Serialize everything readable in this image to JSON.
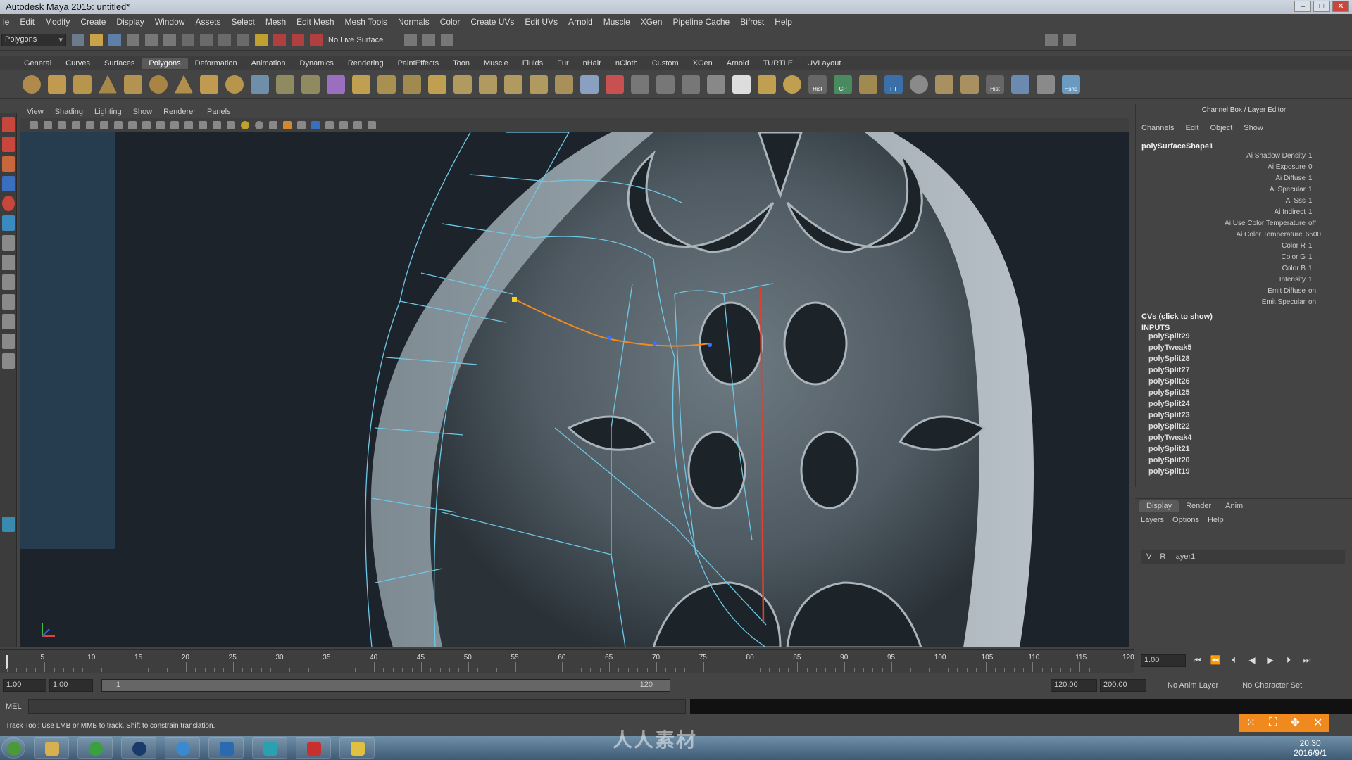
{
  "window": {
    "title": "Autodesk Maya 2015: untitled*"
  },
  "menubar": [
    "le",
    "Edit",
    "Modify",
    "Create",
    "Display",
    "Window",
    "Assets",
    "Select",
    "Mesh",
    "Edit Mesh",
    "Mesh Tools",
    "Normals",
    "Color",
    "Create UVs",
    "Edit UVs",
    "Arnold",
    "Muscle",
    "XGen",
    "Pipeline Cache",
    "Bifrost",
    "Help"
  ],
  "statusline": {
    "mode": "Polygons",
    "live_surface": "No Live Surface"
  },
  "shelf_tabs": [
    "General",
    "Curves",
    "Surfaces",
    "Polygons",
    "Deformation",
    "Animation",
    "Dynamics",
    "Rendering",
    "PaintEffects",
    "Toon",
    "Muscle",
    "Fluids",
    "Fur",
    "nHair",
    "nCloth",
    "Custom",
    "XGen",
    "Arnold",
    "TURTLE",
    "UVLayout"
  ],
  "active_shelf_tab": "Polygons",
  "shelf_labels": {
    "hist1": "Hist",
    "cp": "CP",
    "ft": "FT",
    "hist2": "Hist",
    "hshd": "Hshd"
  },
  "panel_menu": [
    "View",
    "Shading",
    "Lighting",
    "Show",
    "Renderer",
    "Panels"
  ],
  "channel_box": {
    "title": "Channel Box / Layer Editor",
    "menu": [
      "Channels",
      "Edit",
      "Object",
      "Show"
    ],
    "object": "polySurfaceShape1",
    "attributes": [
      {
        "name": "Ai Shadow Density",
        "value": "1"
      },
      {
        "name": "Ai Exposure",
        "value": "0"
      },
      {
        "name": "Ai Diffuse",
        "value": "1"
      },
      {
        "name": "Ai Specular",
        "value": "1"
      },
      {
        "name": "Ai Sss",
        "value": "1"
      },
      {
        "name": "Ai Indirect",
        "value": "1"
      },
      {
        "name": "Ai Use Color Temperature",
        "value": "off"
      },
      {
        "name": "Ai Color Temperature",
        "value": "6500"
      },
      {
        "name": "Color R",
        "value": "1"
      },
      {
        "name": "Color G",
        "value": "1"
      },
      {
        "name": "Color B",
        "value": "1"
      },
      {
        "name": "Intensity",
        "value": "1"
      },
      {
        "name": "Emit Diffuse",
        "value": "on"
      },
      {
        "name": "Emit Specular",
        "value": "on"
      }
    ],
    "cvs_label": "CVs (click to show)",
    "inputs_label": "INPUTS",
    "inputs": [
      "polySplit29",
      "polyTweak5",
      "polySplit28",
      "polySplit27",
      "polySplit26",
      "polySplit25",
      "polySplit24",
      "polySplit23",
      "polySplit22",
      "polyTweak4",
      "polySplit21",
      "polySplit20",
      "polySplit19"
    ]
  },
  "layer_editor": {
    "tabs": [
      "Display",
      "Render",
      "Anim"
    ],
    "active_tab": "Display",
    "menu": [
      "Layers",
      "Options",
      "Help"
    ],
    "layer": {
      "v": "V",
      "r": "R",
      "name": "layer1"
    }
  },
  "timeline": {
    "ticks": [
      "5",
      "10",
      "15",
      "20",
      "25",
      "30",
      "35",
      "40",
      "45",
      "50",
      "55",
      "60",
      "65",
      "70",
      "75",
      "80",
      "85",
      "90",
      "95",
      "100",
      "105",
      "110",
      "115",
      "120"
    ],
    "current_frame": "1.00"
  },
  "range_slider": {
    "start": "1.00",
    "playback_start": "1.00",
    "range_start": "1",
    "range_end": "120",
    "playback_end": "120.00",
    "end": "200.00",
    "anim_layer": "No Anim Layer",
    "character_set": "No Character Set"
  },
  "command_line": {
    "label": "MEL"
  },
  "help_line": "Track Tool: Use LMB or MMB to track. Shift to constrain translation.",
  "taskbar": {
    "time": "20:30",
    "date": "2016/9/1"
  },
  "watermark": "人人素材",
  "colors": {
    "accent": "#f08a1e",
    "wire": "#6ec8e6",
    "selection_edge": "#f28a1e",
    "seam": "#e0402a"
  }
}
